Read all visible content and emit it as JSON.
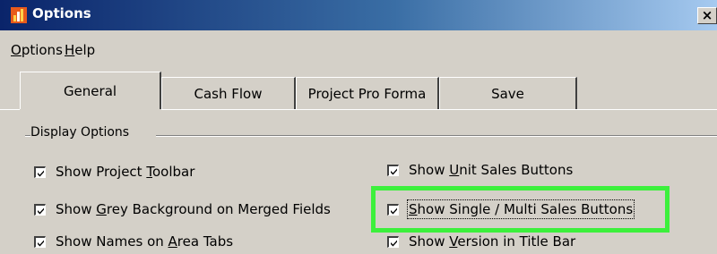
{
  "window": {
    "title": "Options",
    "close_glyph": "×"
  },
  "menu": {
    "items": [
      {
        "label": "Options",
        "accel": "O",
        "rest": "ptions"
      },
      {
        "label": "Help",
        "accel": "H",
        "rest": "elp"
      }
    ]
  },
  "tabs": [
    {
      "label": "General",
      "active": true
    },
    {
      "label": "Cash Flow",
      "active": false
    },
    {
      "label": "Project Pro Forma",
      "active": false
    },
    {
      "label": "Save",
      "active": false
    }
  ],
  "group": {
    "label": "Display Options"
  },
  "options": {
    "left": [
      {
        "before": "Show Project ",
        "accel": "T",
        "after": "oolbar",
        "checked": true
      },
      {
        "before": "Show ",
        "accel": "G",
        "after": "rey Background on Merged Fields",
        "checked": true
      },
      {
        "before": "Show Names on ",
        "accel": "A",
        "after": "rea Tabs",
        "checked": true
      }
    ],
    "right": [
      {
        "before": "Show ",
        "accel": "U",
        "after": "nit Sales Buttons",
        "checked": true
      },
      {
        "before": "",
        "accel": "S",
        "after": "how Single / Multi Sales Buttons",
        "checked": true,
        "focused": true
      },
      {
        "before": "Show ",
        "accel": "V",
        "after": "ersion in Title Bar",
        "checked": true
      }
    ]
  },
  "colors": {
    "highlight": "#3cf03c",
    "titlebar_start": "#0a246a",
    "titlebar_end": "#a6caf0"
  },
  "icons": {
    "app": "app-logo-icon",
    "close": "close-icon",
    "check": "checkmark-icon"
  }
}
